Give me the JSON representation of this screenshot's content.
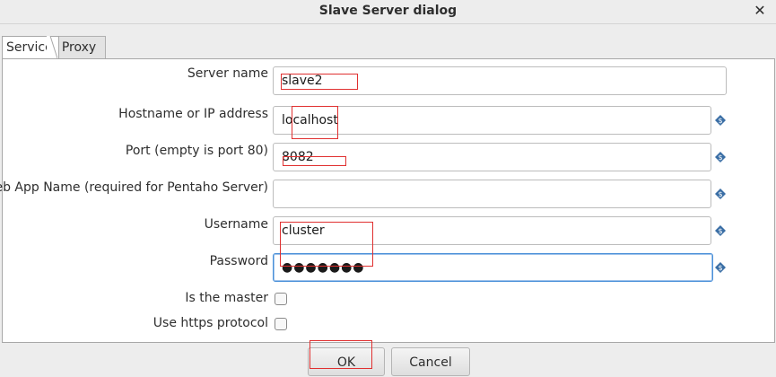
{
  "dialog": {
    "title": "Slave Server dialog"
  },
  "tabs": [
    {
      "label": "Service"
    },
    {
      "label": "Proxy"
    }
  ],
  "form": {
    "server_name": {
      "label": "Server name",
      "value": "slave2"
    },
    "hostname": {
      "label": "Hostname or IP address",
      "value": "localhost"
    },
    "port": {
      "label": "Port (empty is port 80)",
      "value": "8082"
    },
    "webapp": {
      "label": "Web App Name (required for Pentaho Server)",
      "value": ""
    },
    "username": {
      "label": "Username",
      "value": "cluster"
    },
    "password": {
      "label": "Password",
      "value": "●●●●●●●"
    },
    "is_master": {
      "label": "Is the master",
      "checked": false
    },
    "use_https": {
      "label": "Use https protocol",
      "checked": false
    }
  },
  "buttons": {
    "ok": "OK",
    "cancel": "Cancel"
  },
  "icons": {
    "close": "close-icon",
    "variable": "variable-diamond-icon"
  },
  "colors": {
    "focus_border": "#4a90d9",
    "annotation_box": "#e03030",
    "variable_icon": "#3a6ea5"
  }
}
